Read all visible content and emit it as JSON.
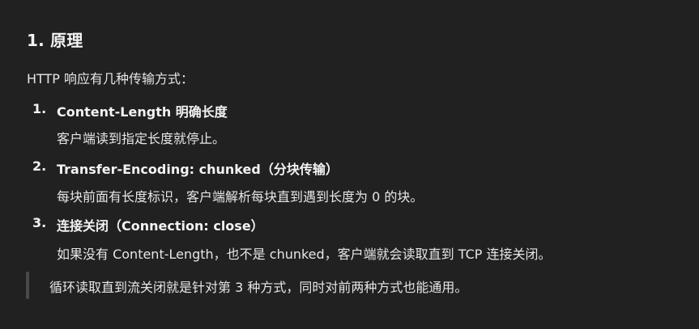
{
  "section": {
    "heading": "1. 原理",
    "intro": "HTTP 响应有几种传输方式："
  },
  "items": [
    {
      "num": "1.",
      "title": "Content-Length 明确长度",
      "desc": "客户端读到指定长度就停止。"
    },
    {
      "num": "2.",
      "title": "Transfer-Encoding: chunked（分块传输）",
      "desc": "每块前面有长度标识，客户端解析每块直到遇到长度为 0 的块。"
    },
    {
      "num": "3.",
      "title": "连接关闭（Connection: close）",
      "desc": "如果没有 Content-Length，也不是 chunked，客户端就会读取直到 TCP 连接关闭。"
    }
  ],
  "quote": {
    "text": "循环读取直到流关闭就是针对第 3 种方式，同时对前两种方式也能通用。"
  }
}
